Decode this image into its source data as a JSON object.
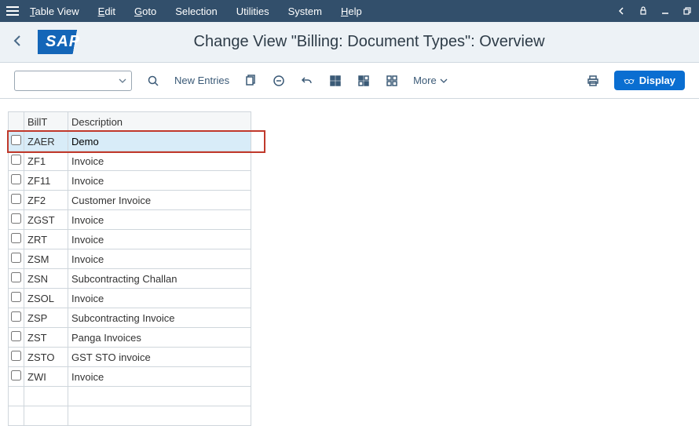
{
  "menu": {
    "items": [
      {
        "label": "Table View",
        "accel": "T"
      },
      {
        "label": "Edit",
        "accel": "E"
      },
      {
        "label": "Goto",
        "accel": "G"
      },
      {
        "label": "Selection",
        "accel": null
      },
      {
        "label": "Utilities",
        "accel": null
      },
      {
        "label": "System",
        "accel": null
      },
      {
        "label": "Help",
        "accel": "H"
      }
    ]
  },
  "title": "Change View \"Billing: Document Types\": Overview",
  "toolbar": {
    "new_entries": "New Entries",
    "more": "More",
    "display": "Display"
  },
  "table": {
    "headers": {
      "billt": "BillT",
      "desc": "Description"
    },
    "rows": [
      {
        "billt": "ZAER",
        "desc": "Demo",
        "highlight": true,
        "editable": true
      },
      {
        "billt": "ZF1",
        "desc": "Invoice"
      },
      {
        "billt": "ZF11",
        "desc": "Invoice"
      },
      {
        "billt": "ZF2",
        "desc": "Customer Invoice"
      },
      {
        "billt": "ZGST",
        "desc": "Invoice"
      },
      {
        "billt": "ZRT",
        "desc": "Invoice"
      },
      {
        "billt": "ZSM",
        "desc": "Invoice"
      },
      {
        "billt": "ZSN",
        "desc": "Subcontracting Challan"
      },
      {
        "billt": "ZSOL",
        "desc": "Invoice"
      },
      {
        "billt": "ZSP",
        "desc": "Subcontracting Invoice"
      },
      {
        "billt": "ZST",
        "desc": "Panga Invoices"
      },
      {
        "billt": "ZSTO",
        "desc": "GST STO invoice"
      },
      {
        "billt": "ZWI",
        "desc": "Invoice"
      }
    ]
  }
}
